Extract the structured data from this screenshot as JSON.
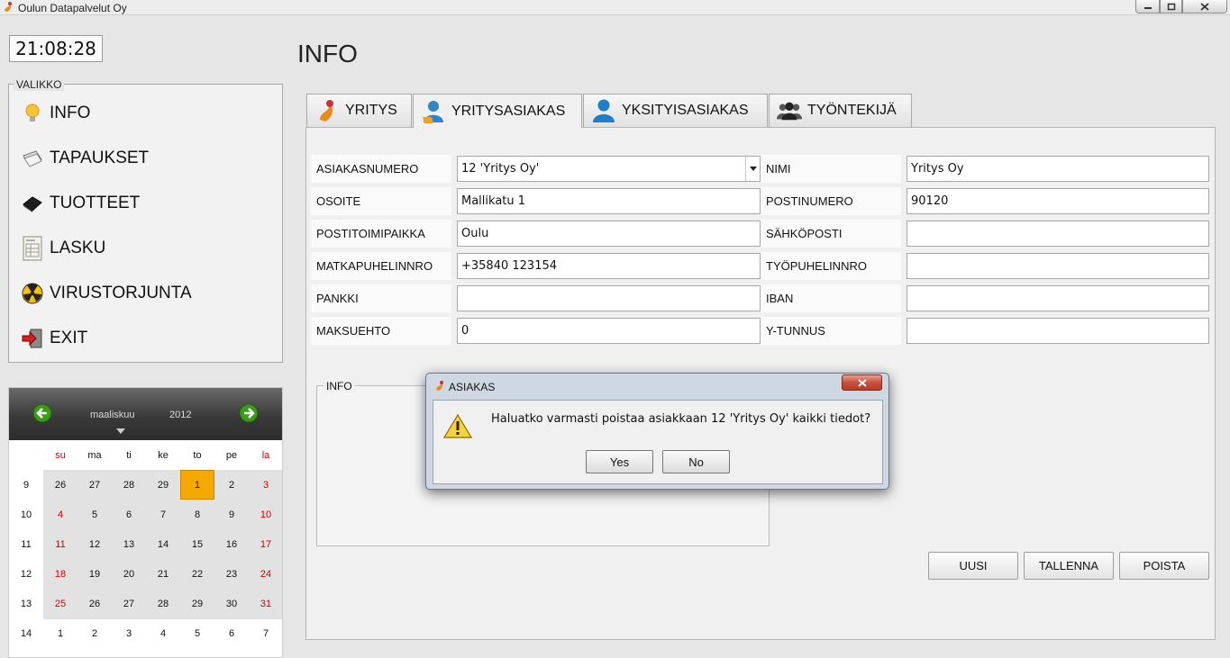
{
  "window": {
    "title": "Oulun Datapalvelut Oy"
  },
  "clock": "21:08:28",
  "page_title": "INFO",
  "menu": {
    "legend": "VALIKKO",
    "items": [
      {
        "label": "INFO",
        "icon": "lightbulb-icon"
      },
      {
        "label": "TAPAUKSET",
        "icon": "paper-stack-icon"
      },
      {
        "label": "TUOTTEET",
        "icon": "black-box-icon"
      },
      {
        "label": "LASKU",
        "icon": "invoice-icon"
      },
      {
        "label": "VIRUSTORJUNTA",
        "icon": "radiation-icon"
      },
      {
        "label": "EXIT",
        "icon": "exit-door-icon"
      }
    ]
  },
  "calendar": {
    "month": "maaliskuu",
    "year": "2012",
    "weekdays": [
      "su",
      "ma",
      "ti",
      "ke",
      "to",
      "pe",
      "la"
    ],
    "weeks": [
      {
        "week": "9",
        "days": [
          "26",
          "27",
          "28",
          "29",
          "1",
          "2",
          "3"
        ]
      },
      {
        "week": "10",
        "days": [
          "4",
          "5",
          "6",
          "7",
          "8",
          "9",
          "10"
        ]
      },
      {
        "week": "11",
        "days": [
          "11",
          "12",
          "13",
          "14",
          "15",
          "16",
          "17"
        ]
      },
      {
        "week": "12",
        "days": [
          "18",
          "19",
          "20",
          "21",
          "22",
          "23",
          "24"
        ]
      },
      {
        "week": "13",
        "days": [
          "25",
          "26",
          "27",
          "28",
          "29",
          "30",
          "31"
        ]
      },
      {
        "week": "14",
        "days": [
          "1",
          "2",
          "3",
          "4",
          "5",
          "6",
          "7"
        ]
      }
    ],
    "selected_day": "1"
  },
  "tabs": [
    {
      "label": "YRITYS",
      "icon": "company-logo-icon"
    },
    {
      "label": "YRITYSASIAKAS",
      "icon": "business-customer-icon",
      "active": true
    },
    {
      "label": "YKSITYISASIAKAS",
      "icon": "person-icon"
    },
    {
      "label": "TYÖNTEKIJÄ",
      "icon": "group-icon"
    }
  ],
  "form": {
    "left": [
      {
        "label": "ASIAKASNUMERO",
        "value": "12 'Yritys Oy'",
        "type": "select"
      },
      {
        "label": "OSOITE",
        "value": "Mallikatu 1"
      },
      {
        "label": "POSTITOIMIPAIKKA",
        "value": "Oulu"
      },
      {
        "label": "MATKAPUHELINNRO",
        "value": "+35840 123154"
      },
      {
        "label": "PANKKI",
        "value": ""
      },
      {
        "label": "MAKSUEHTO",
        "value": "0"
      }
    ],
    "right": [
      {
        "label": "NIMI",
        "value": "Yritys Oy"
      },
      {
        "label": "POSTINUMERO",
        "value": "90120"
      },
      {
        "label": "SÄHKÖPOSTI",
        "value": ""
      },
      {
        "label": "TYÖPUHELINNRO",
        "value": ""
      },
      {
        "label": "IBAN",
        "value": ""
      },
      {
        "label": "Y-TUNNUS",
        "value": ""
      }
    ],
    "info_legend": "INFO"
  },
  "actions": {
    "new": "UUSI",
    "save": "TALLENNA",
    "delete": "POISTA"
  },
  "dialog": {
    "title": "ASIAKAS",
    "message": "Haluatko varmasti poistaa asiakkaan 12 'Yritys Oy' kaikki tiedot?",
    "yes": "Yes",
    "no": "No"
  },
  "colors": {
    "selected_day": "#f5a800",
    "weekend_red": "#d00000",
    "accent_green": "#3a9a1a"
  }
}
